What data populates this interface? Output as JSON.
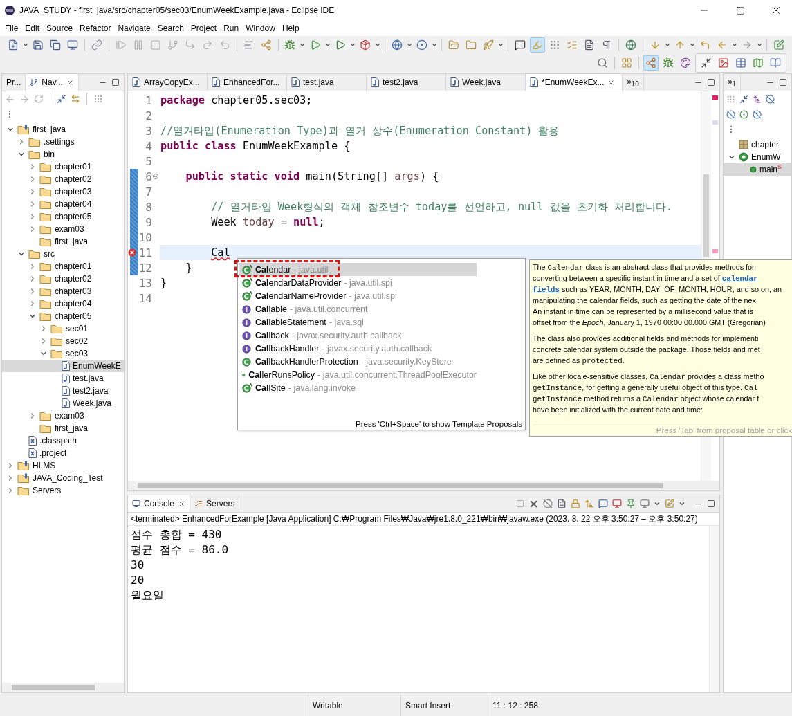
{
  "window": {
    "title": "JAVA_STUDY - first_java/src/chapter05/sec03/EnumWeekExample.java - Eclipse IDE"
  },
  "menu": [
    "File",
    "Edit",
    "Source",
    "Refactor",
    "Navigate",
    "Search",
    "Project",
    "Run",
    "Window",
    "Help"
  ],
  "navigator": {
    "tabs": [
      {
        "label": "Pr...",
        "selected": false
      },
      {
        "label": "Nav...",
        "selected": true
      }
    ],
    "tree": [
      {
        "label": "first_java",
        "kind": "project",
        "expanded": true,
        "selected": false,
        "children": [
          {
            "label": ".settings",
            "kind": "folder",
            "expanded": false,
            "selected": false
          },
          {
            "label": "bin",
            "kind": "folder",
            "expanded": true,
            "selected": false,
            "children": [
              {
                "label": "chapter01",
                "kind": "folder",
                "expanded": false,
                "selected": false
              },
              {
                "label": "chapter02",
                "kind": "folder",
                "expanded": false,
                "selected": false
              },
              {
                "label": "chapter03",
                "kind": "folder",
                "expanded": false,
                "selected": false
              },
              {
                "label": "chapter04",
                "kind": "folder",
                "expanded": false,
                "selected": false
              },
              {
                "label": "chapter05",
                "kind": "folder",
                "expanded": false,
                "selected": false
              },
              {
                "label": "exam03",
                "kind": "folder",
                "expanded": false,
                "selected": false
              },
              {
                "label": "first_java",
                "kind": "folder",
                "selected": false
              }
            ]
          },
          {
            "label": "src",
            "kind": "folder",
            "expanded": true,
            "selected": false,
            "children": [
              {
                "label": "chapter01",
                "kind": "folder",
                "expanded": false,
                "selected": false
              },
              {
                "label": "chapter02",
                "kind": "folder",
                "expanded": false,
                "selected": false
              },
              {
                "label": "chapter03",
                "kind": "folder",
                "expanded": false,
                "selected": false
              },
              {
                "label": "chapter04",
                "kind": "folder",
                "expanded": false,
                "selected": false
              },
              {
                "label": "chapter05",
                "kind": "folder",
                "expanded": true,
                "selected": false,
                "children": [
                  {
                    "label": "sec01",
                    "kind": "folder",
                    "expanded": false,
                    "selected": false
                  },
                  {
                    "label": "sec02",
                    "kind": "folder",
                    "expanded": false,
                    "selected": false
                  },
                  {
                    "label": "sec03",
                    "kind": "folder",
                    "expanded": true,
                    "selected": false,
                    "children": [
                      {
                        "label": "EnumWeekE",
                        "kind": "java",
                        "selected": true
                      },
                      {
                        "label": "test.java",
                        "kind": "java",
                        "selected": false
                      },
                      {
                        "label": "test2.java",
                        "kind": "java",
                        "selected": false
                      },
                      {
                        "label": "Week.java",
                        "kind": "java",
                        "selected": false
                      }
                    ]
                  }
                ]
              },
              {
                "label": "exam03",
                "kind": "folder",
                "expanded": false,
                "selected": false
              },
              {
                "label": "first_java",
                "kind": "folder",
                "selected": false
              }
            ]
          },
          {
            "label": ".classpath",
            "kind": "xml",
            "selected": false
          },
          {
            "label": ".project",
            "kind": "xml",
            "selected": false
          }
        ]
      },
      {
        "label": "HLMS",
        "kind": "project",
        "expanded": false,
        "selected": false
      },
      {
        "label": "JAVA_Coding_Test",
        "kind": "project",
        "expanded": false,
        "selected": false
      },
      {
        "label": "Servers",
        "kind": "folder",
        "expanded": false,
        "selected": false
      }
    ]
  },
  "editor": {
    "tabs": [
      {
        "label": "ArrayCopyEx...",
        "selected": false
      },
      {
        "label": "EnhancedFor...",
        "selected": false
      },
      {
        "label": "test.java",
        "selected": false
      },
      {
        "label": "test2.java",
        "selected": false
      },
      {
        "label": "Week.java",
        "selected": false
      },
      {
        "label": "*EnumWeekEx...",
        "selected": true
      }
    ],
    "overflow": "»$_{10}$",
    "lines": [
      {
        "number": "1",
        "changed": false,
        "current": false,
        "error": false,
        "fold": false,
        "tokens": [
          {
            "kind": "keyword",
            "text": "package"
          },
          {
            "kind": "plain",
            "text": " chapter05.sec03;"
          }
        ]
      },
      {
        "number": "2",
        "changed": false,
        "current": false,
        "error": false,
        "fold": false
      },
      {
        "number": "3",
        "changed": false,
        "current": false,
        "error": false,
        "fold": false,
        "tokens": [
          {
            "kind": "comment",
            "text": "//열겨타입(Enumeration Type)과 열거 상수(Enumeration Constant) 활용"
          }
        ]
      },
      {
        "number": "4",
        "changed": false,
        "current": false,
        "error": false,
        "fold": false,
        "tokens": [
          {
            "kind": "keyword",
            "text": "public class"
          },
          {
            "kind": "plain",
            "text": " EnumWeekExample {"
          }
        ]
      },
      {
        "number": "5",
        "changed": false,
        "current": false,
        "error": false,
        "fold": false
      },
      {
        "number": "6",
        "changed": true,
        "current": false,
        "error": false,
        "fold": true,
        "tokens": [
          {
            "kind": "keyword",
            "text": "    public static void"
          },
          {
            "kind": "plain",
            "text": " main(String[] "
          },
          {
            "kind": "variable",
            "text": "args"
          },
          {
            "kind": "plain",
            "text": ") {"
          }
        ]
      },
      {
        "number": "7",
        "changed": true,
        "current": false,
        "error": false,
        "fold": false
      },
      {
        "number": "8",
        "changed": true,
        "current": false,
        "error": false,
        "fold": false,
        "tokens": [
          {
            "kind": "comment",
            "text": "        // 열거타입 Week형식의 객체 참조변수 today를 선언하고, null 값을 초기화 처리합니다."
          }
        ]
      },
      {
        "number": "9",
        "changed": true,
        "current": false,
        "error": false,
        "fold": false,
        "tokens": [
          {
            "kind": "plain",
            "text": "        Week "
          },
          {
            "kind": "variable",
            "text": "today"
          },
          {
            "kind": "plain",
            "text": " = "
          },
          {
            "kind": "keyword",
            "text": "null"
          },
          {
            "kind": "plain",
            "text": ";"
          }
        ]
      },
      {
        "number": "10",
        "changed": true,
        "current": false,
        "error": false,
        "fold": false
      },
      {
        "number": "11",
        "changed": true,
        "current": true,
        "error": true,
        "fold": false,
        "tokens": [
          {
            "kind": "error",
            "text": "        Cal"
          }
        ]
      },
      {
        "number": "12",
        "changed": true,
        "current": false,
        "error": false,
        "fold": false,
        "tokens": [
          {
            "kind": "plain",
            "text": "    }"
          }
        ]
      },
      {
        "number": "13",
        "changed": false,
        "current": false,
        "error": false,
        "fold": false,
        "tokens": [
          {
            "kind": "plain",
            "text": "}"
          }
        ]
      },
      {
        "number": "14",
        "changed": false,
        "current": false,
        "error": false,
        "fold": false
      }
    ]
  },
  "completion": {
    "items": [
      {
        "kind": "abstract_class",
        "name": "**Cal**endar",
        "package": "- java.util",
        "selected": true
      },
      {
        "kind": "abstract_class",
        "name": "**Cal**endarDataProvider",
        "package": "- java.util.spi",
        "selected": false
      },
      {
        "kind": "abstract_class",
        "name": "**Cal**endarNameProvider",
        "package": "- java.util.spi",
        "selected": false
      },
      {
        "kind": "interface",
        "name": "**Cal**lable",
        "package": "- java.util.concurrent",
        "selected": false
      },
      {
        "kind": "interface",
        "name": "**Cal**lableStatement",
        "package": "- java.sql",
        "selected": false
      },
      {
        "kind": "interface",
        "name": "**Cal**lback",
        "package": "- javax.security.auth.callback",
        "selected": false
      },
      {
        "kind": "interface",
        "name": "**Cal**lbackHandler",
        "package": "- javax.security.auth.callback",
        "selected": false
      },
      {
        "kind": "class",
        "name": "**Cal**lbackHandlerProtection",
        "package": "- java.security.KeyStore",
        "selected": false
      },
      {
        "kind": "class",
        "name": "**Cal**lerRunsPolicy",
        "package": "- java.util.concurrent.ThreadPoolExecutor",
        "selected": false
      },
      {
        "kind": "abstract_class",
        "name": "**Cal**lSite",
        "package": "- java.lang.invoke",
        "selected": false
      }
    ],
    "footer": "Press 'Ctrl+Space' to show Template Proposals"
  },
  "javadoc": {
    "paragraphs": [
      [
        [
          {
            "kind": "text",
            "text": "The "
          },
          {
            "kind": "code",
            "text": "Calendar"
          },
          {
            "kind": "text",
            "text": " class is an abstract class that provides methods for"
          }
        ],
        [
          {
            "kind": "text",
            "text": "converting between a specific instant in time and a set of "
          },
          {
            "kind": "link",
            "text": "calendar"
          }
        ],
        [
          {
            "kind": "link",
            "text": "fields"
          },
          {
            "kind": "text",
            "text": " such as YEAR, MONTH, DAY_OF_MONTH, HOUR, and so on, an"
          }
        ],
        [
          {
            "kind": "text",
            "text": "manipulating the calendar fields, such as getting the date of the nex"
          }
        ],
        [
          {
            "kind": "text",
            "text": "An instant in time can be represented by a millisecond value that is"
          }
        ],
        [
          {
            "kind": "text",
            "text": "offset from the *Epoch*, January 1, 1970 00:00:00.000 GMT (Gregorian)"
          }
        ]
      ],
      [
        [
          {
            "kind": "text",
            "text": "The class also provides additional fields and methods for implementi"
          }
        ],
        [
          {
            "kind": "text",
            "text": "concrete calendar system outside the package. Those fields and met"
          }
        ],
        [
          {
            "kind": "text",
            "text": "are defined as "
          },
          {
            "kind": "code",
            "text": "protected"
          },
          {
            "kind": "text",
            "text": "."
          }
        ]
      ],
      [
        [
          {
            "kind": "text",
            "text": "Like other locale-sensitive classes, "
          },
          {
            "kind": "code",
            "text": "Calendar"
          },
          {
            "kind": "text",
            "text": " provides a class metho"
          }
        ],
        [
          {
            "kind": "code",
            "text": "getInstance"
          },
          {
            "kind": "text",
            "text": ", for getting a generally useful object of this type. "
          },
          {
            "kind": "code",
            "text": "Cal"
          }
        ],
        [
          {
            "kind": "code",
            "text": "getInstance"
          },
          {
            "kind": "text",
            "text": " method returns a "
          },
          {
            "kind": "code",
            "text": "Calendar"
          },
          {
            "kind": "text",
            "text": " object whose calendar f"
          }
        ],
        [
          {
            "kind": "text",
            "text": "have been initialized with the current date and time:"
          }
        ]
      ]
    ],
    "footer": "Press 'Tab' from proposal table or click"
  },
  "console": {
    "tabs": [
      {
        "label": "Console",
        "selected": true
      },
      {
        "label": "Servers",
        "selected": false
      }
    ],
    "status": "<terminated> EnhancedForExample [Java Application] C:₩Program Files₩Java₩jre1.8.0_221₩bin₩javaw.exe  (2023. 8. 22 오후 3:50:27 – 오후 3:50:27)",
    "output": [
      "점수 총합 = 430",
      "평균 점수 = 86.0",
      "30",
      "20",
      "월요일"
    ]
  },
  "outline": {
    "tab": "»$_{1}$",
    "items": [
      {
        "label": "chapter",
        "kind": "package",
        "selected": false
      },
      {
        "label": "EnumW",
        "kind": "class",
        "expanded": true,
        "selected": false,
        "children": [
          {
            "label": "main",
            "kind": "method",
            "modifier": "S",
            "selected": true
          }
        ]
      }
    ]
  },
  "status_bar": {
    "mode": "Writable",
    "insert": "Smart Insert",
    "position": "11 : 12 : 258"
  }
}
